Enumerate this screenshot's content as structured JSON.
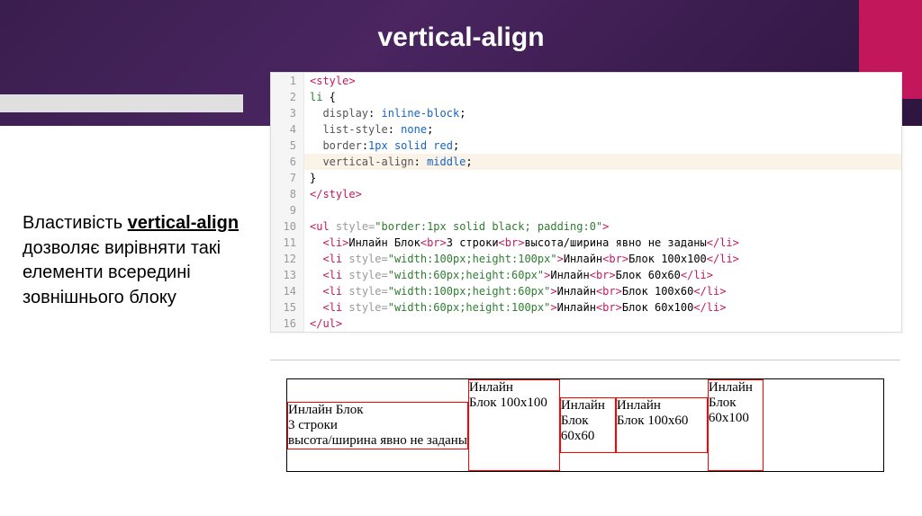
{
  "title": "vertical-align",
  "description_prefix": "Властивість ",
  "description_bold": "vertical-align",
  "description_rest": " дозволяє вирівняти такі елементи всередині зовнішнього блоку",
  "code_lines": [
    {
      "n": 1,
      "html": "<span class='t-tag'>&lt;style&gt;</span>"
    },
    {
      "n": 2,
      "html": "<span class='t-sel'>li</span> {"
    },
    {
      "n": 3,
      "html": "  <span class='t-prop'>display</span>: <span class='t-val'>inline-block</span>;"
    },
    {
      "n": 4,
      "html": "  <span class='t-prop'>list-style</span>: <span class='t-val'>none</span>;"
    },
    {
      "n": 5,
      "html": "  <span class='t-prop'>border</span>:<span class='t-val'>1px solid red</span>;"
    },
    {
      "n": 6,
      "hl": true,
      "html": "  <span class='t-prop'>vertical-align</span>: <span class='t-val'>middle</span>;"
    },
    {
      "n": 7,
      "html": "}"
    },
    {
      "n": 8,
      "html": "<span class='t-tag'>&lt;/style&gt;</span>"
    },
    {
      "n": 9,
      "html": " "
    },
    {
      "n": 10,
      "html": "<span class='t-tag'>&lt;ul</span> <span class='t-attr'>style=</span><span class='t-str'>\"border:1px solid black; padding:0\"</span><span class='t-tag'>&gt;</span>"
    },
    {
      "n": 11,
      "html": "  <span class='t-tag'>&lt;li&gt;</span>Инлайн Блок<span class='t-tag'>&lt;br&gt;</span>3 строки<span class='t-tag'>&lt;br&gt;</span>высота/ширина явно не заданы<span class='t-tag'>&lt;/li&gt;</span>"
    },
    {
      "n": 12,
      "html": "  <span class='t-tag'>&lt;li</span> <span class='t-attr'>style=</span><span class='t-str'>\"width:100px;height:100px\"</span><span class='t-tag'>&gt;</span>Инлайн<span class='t-tag'>&lt;br&gt;</span>Блок 100x100<span class='t-tag'>&lt;/li&gt;</span>"
    },
    {
      "n": 13,
      "html": "  <span class='t-tag'>&lt;li</span> <span class='t-attr'>style=</span><span class='t-str'>\"width:60px;height:60px\"</span><span class='t-tag'>&gt;</span>Инлайн<span class='t-tag'>&lt;br&gt;</span>Блок 60x60<span class='t-tag'>&lt;/li&gt;</span>"
    },
    {
      "n": 14,
      "html": "  <span class='t-tag'>&lt;li</span> <span class='t-attr'>style=</span><span class='t-str'>\"width:100px;height:60px\"</span><span class='t-tag'>&gt;</span>Инлайн<span class='t-tag'>&lt;br&gt;</span>Блок 100x60<span class='t-tag'>&lt;/li&gt;</span>"
    },
    {
      "n": 15,
      "html": "  <span class='t-tag'>&lt;li</span> <span class='t-attr'>style=</span><span class='t-str'>\"width:60px;height:100px\"</span><span class='t-tag'>&gt;</span>Инлайн<span class='t-tag'>&lt;br&gt;</span>Блок 60x100<span class='t-tag'>&lt;/li&gt;</span>"
    },
    {
      "n": 16,
      "html": "<span class='t-tag'>&lt;/ul&gt;</span>"
    }
  ],
  "preview_items": [
    {
      "style": "",
      "html": "Инлайн Блок<br>3 строки<br>высота/ширина явно не заданы"
    },
    {
      "style": "width:100px;height:100px",
      "html": "Инлайн<br>Блок 100x100"
    },
    {
      "style": "width:60px;height:60px",
      "html": "Инлайн<br>Блок 60x60"
    },
    {
      "style": "width:100px;height:60px",
      "html": "Инлайн<br>Блок 100x60"
    },
    {
      "style": "width:60px;height:100px",
      "html": "Инлайн<br>Блок 60x100"
    }
  ]
}
